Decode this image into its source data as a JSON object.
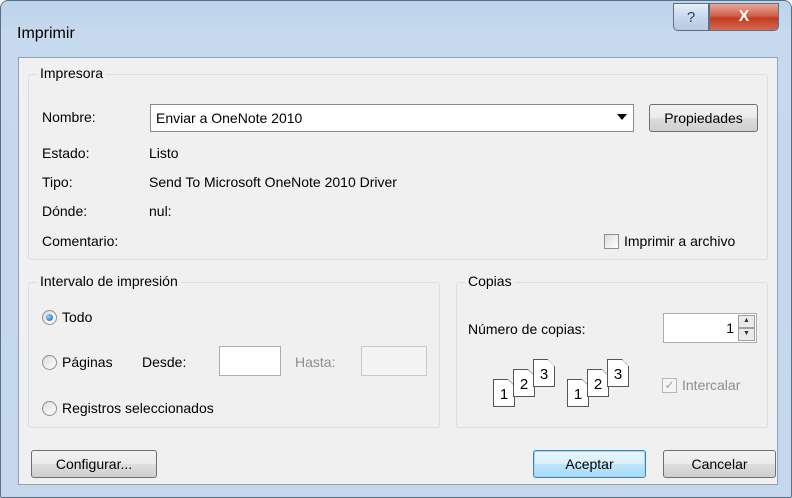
{
  "window": {
    "title": "Imprimir",
    "help_glyph": "?",
    "close_glyph": "X"
  },
  "printer": {
    "legend": "Impresora",
    "name_label": "Nombre:",
    "name_value": "Enviar a OneNote 2010",
    "properties_button": "Propiedades",
    "status_label": "Estado:",
    "status_value": "Listo",
    "type_label": "Tipo:",
    "type_value": "Send To Microsoft OneNote 2010 Driver",
    "where_label": "Dónde:",
    "where_value": "nul:",
    "comment_label": "Comentario:",
    "print_to_file_label": "Imprimir a archivo",
    "print_to_file_checked": false
  },
  "range": {
    "legend": "Intervalo de impresión",
    "all_label": "Todo",
    "all_selected": true,
    "pages_label": "Páginas",
    "from_label": "Desde:",
    "to_label": "Hasta:",
    "selection_label": "Registros seleccionados"
  },
  "copies": {
    "legend": "Copias",
    "count_label": "Número de copias:",
    "count_value": "1",
    "collate_label": "Intercalar",
    "collate_checked": true,
    "collate_icon_pages": [
      "1",
      "2",
      "3"
    ]
  },
  "footer": {
    "setup_button": "Configurar...",
    "ok_button": "Aceptar",
    "cancel_button": "Cancelar"
  }
}
